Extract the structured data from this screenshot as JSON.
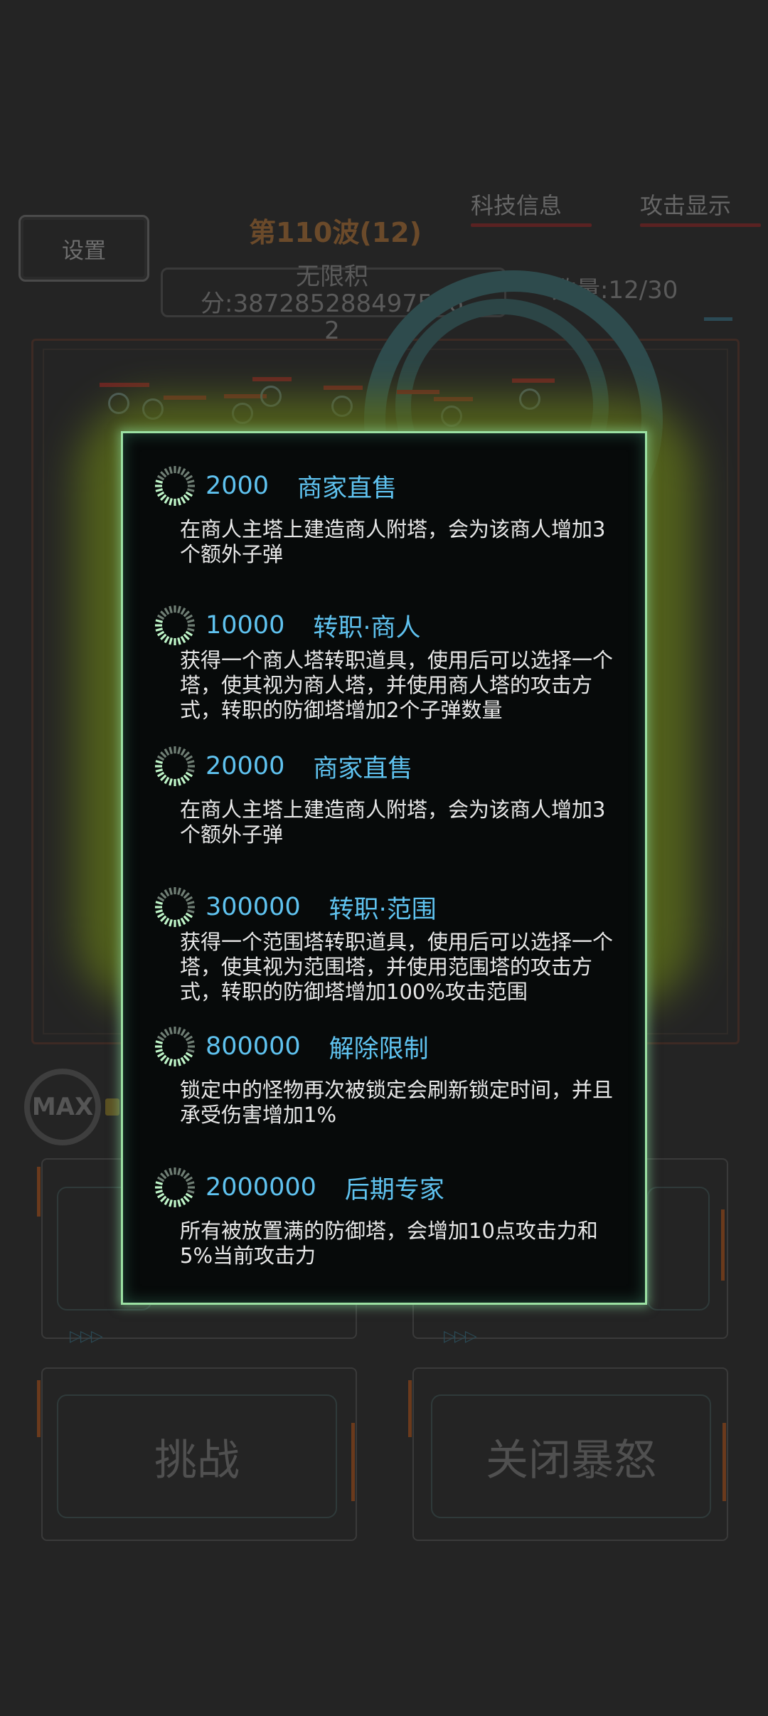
{
  "hud": {
    "settings_label": "设置",
    "wave_title": "第110波(12)",
    "tab_tech": "科技信息",
    "tab_attack": "攻击显示",
    "score_line1": "无限积分:387285288497596",
    "score_line2": "2",
    "count_text": "数量:12/30",
    "max_badge": "MAX",
    "challenge_label": "挑战",
    "rage_label": "关闭暴怒",
    "arrows": "▷▷▷"
  },
  "tech_list": {
    "items": [
      {
        "cost": "2000",
        "name": "商家直售",
        "desc": "在商人主塔上建造商人附塔，会为该商人增加3个额外子弹",
        "icon": "loading-spinner-icon"
      },
      {
        "cost": "10000",
        "name": "转职·商人",
        "desc": "获得一个商人塔转职道具，使用后可以选择一个塔，使其视为商人塔，并使用商人塔的攻击方式，转职的防御塔增加2个子弹数量",
        "icon": "loading-spinner-icon"
      },
      {
        "cost": "20000",
        "name": "商家直售",
        "desc": "在商人主塔上建造商人附塔，会为该商人增加3个额外子弹",
        "icon": "loading-spinner-icon"
      },
      {
        "cost": "300000",
        "name": "转职·范围",
        "desc": "获得一个范围塔转职道具，使用后可以选择一个塔，使其视为范围塔，并使用范围塔的攻击方式，转职的防御塔增加100%攻击范围",
        "icon": "loading-spinner-icon"
      },
      {
        "cost": "800000",
        "name": "解除限制",
        "desc": "锁定中的怪物再次被锁定会刷新锁定时间，并且承受伤害增加1%",
        "icon": "loading-spinner-icon"
      },
      {
        "cost": "2000000",
        "name": "后期专家",
        "desc": "所有被放置满的防御塔，会增加10点攻击力和5%当前攻击力",
        "icon": "loading-spinner-icon"
      }
    ]
  },
  "colors": {
    "accent_text": "#5fc2ef",
    "dialog_border": "#9be0a2",
    "background": "#242424"
  }
}
